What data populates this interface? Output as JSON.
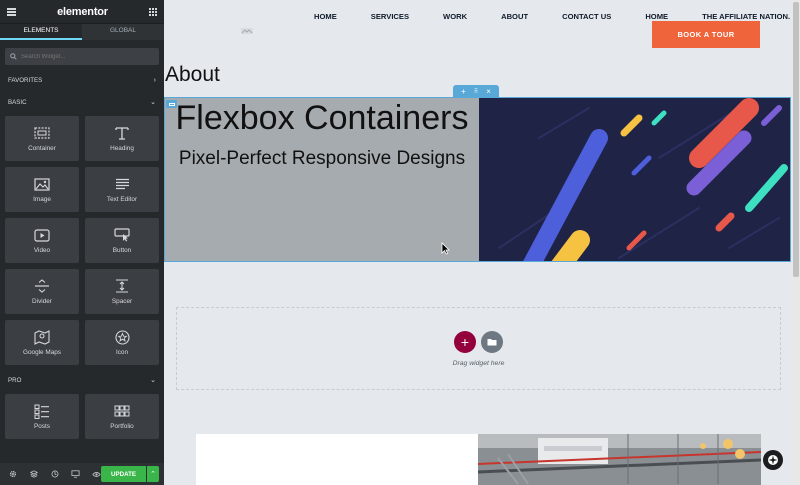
{
  "sidebar": {
    "logo": "elementor",
    "tabs": [
      "ELEMENTS",
      "GLOBAL"
    ],
    "search_placeholder": "Search Widget...",
    "categories": {
      "favorites": "FAVORITES",
      "basic": "BASIC",
      "pro": "PRO"
    },
    "basic_widgets": [
      {
        "label": "Container",
        "icon": "container-icon"
      },
      {
        "label": "Heading",
        "icon": "heading-icon"
      },
      {
        "label": "Image",
        "icon": "image-icon"
      },
      {
        "label": "Text Editor",
        "icon": "text-editor-icon"
      },
      {
        "label": "Video",
        "icon": "video-icon"
      },
      {
        "label": "Button",
        "icon": "button-icon"
      },
      {
        "label": "Divider",
        "icon": "divider-icon"
      },
      {
        "label": "Spacer",
        "icon": "spacer-icon"
      },
      {
        "label": "Google Maps",
        "icon": "google-maps-icon"
      },
      {
        "label": "Icon",
        "icon": "star-icon"
      }
    ],
    "pro_widgets": [
      {
        "label": "Posts",
        "icon": "posts-icon"
      },
      {
        "label": "Portfolio",
        "icon": "portfolio-icon"
      }
    ],
    "update_label": "UPDATE",
    "accent_color": "#71d7f7",
    "update_color": "#39b54a"
  },
  "page": {
    "nav": [
      "HOME",
      "SERVICES",
      "WORK",
      "ABOUT",
      "CONTACT US",
      "HOME",
      "THE AFFILIATE NATION."
    ],
    "book_button": "BOOK A TOUR",
    "book_color": "#f0643c",
    "heading": "About",
    "hero": {
      "title": "Flexbox Containers",
      "subtitle": "Pixel-Perfect Responsive Designs"
    },
    "dropzone_text": "Drag widget here",
    "selection_color": "#58a8d8"
  }
}
